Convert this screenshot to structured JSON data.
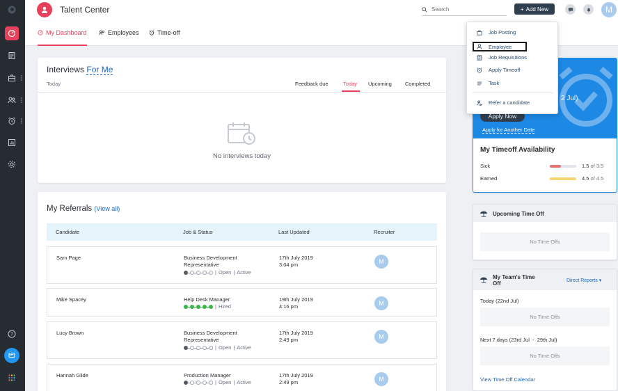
{
  "app": {
    "title": "Talent Center",
    "avatar_initial": "M"
  },
  "search": {
    "placeholder": "Search"
  },
  "header": {
    "add_new_label": "Add New"
  },
  "tabs": [
    {
      "label": "My Dashboard"
    },
    {
      "label": "Employees"
    },
    {
      "label": "Time-off"
    }
  ],
  "add_menu": {
    "items": [
      "Job Posting",
      "Employee",
      "Job Requisitions",
      "Apply Timeoff",
      "Task"
    ],
    "refer_label": "Refer a candidate"
  },
  "interviews": {
    "title": "Interviews",
    "filter": "For Me",
    "subtitle": "Today",
    "tabs": [
      "Feedback due",
      "Today",
      "Upcoming",
      "Completed"
    ],
    "active_tab": "Today",
    "empty_text": "No interviews today"
  },
  "referrals": {
    "title": "My Referrals",
    "view_all": "(View all)",
    "columns": [
      "Candidate",
      "Job & Status",
      "Last Updated",
      "Recruiter"
    ],
    "rows": [
      {
        "candidate": "Sam Page",
        "job_line1": "Business Development",
        "job_line2": "Representative",
        "status": "Open",
        "state": "Active",
        "date": "17th July 2019",
        "time": "3:04 pm",
        "recruiter": "M"
      },
      {
        "candidate": "Mike Spacey",
        "job_line1": "Help Desk Manager",
        "job_line2": "",
        "status": "Hired",
        "state": "",
        "date": "19th July 2019",
        "time": "4:16 pm",
        "recruiter": "M"
      },
      {
        "candidate": "Lucy Brown",
        "job_line1": "Business Development",
        "job_line2": "Representative",
        "status": "Open",
        "state": "Active",
        "date": "17th July 2019",
        "time": "2:49 pm",
        "recruiter": "M"
      },
      {
        "candidate": "Hannah Glide",
        "job_line1": "Production Manager",
        "job_line2": "",
        "status": "Open",
        "state": "Active",
        "date": "17th July 2019",
        "time": "2:49 pm",
        "recruiter": "M"
      }
    ]
  },
  "timeoff_banner": {
    "date_fragment": "2 Jul)",
    "apply_now": "Apply Now",
    "apply_other": "Apply for Another Date"
  },
  "availability": {
    "title": "My Timeoff Availability",
    "items": [
      {
        "label": "Sick",
        "value": "1.5",
        "of": "of",
        "total": "3.5",
        "fraction": 0.43,
        "color": "#e57373"
      },
      {
        "label": "Earned",
        "value": "4.5",
        "of": "of",
        "total": "4.5",
        "fraction": 1.0,
        "color": "#f7d774"
      }
    ]
  },
  "upcoming": {
    "title": "Upcoming Time Off",
    "empty": "No Time Offs"
  },
  "team": {
    "title": "My Team's Time Off",
    "filter": "Direct Reports",
    "today_label": "Today (22nd Jul)",
    "today_empty": "No Time Offs",
    "next_label": "Next 7 days (23rd Jul  -  29th Jul)",
    "next_empty": "No Time Offs",
    "calendar_link": "View Time Off Calendar"
  },
  "colors": {
    "accent": "#e8415b",
    "rail": "#272c33",
    "button": "#2f3f50",
    "banner": "#1e88e5"
  }
}
